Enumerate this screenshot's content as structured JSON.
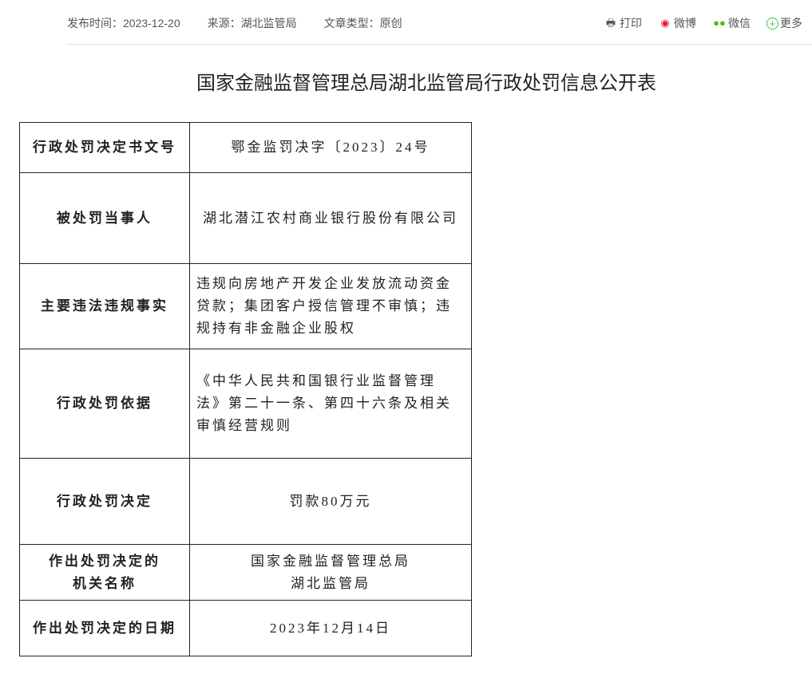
{
  "meta": {
    "date": "发布时间：2023-12-20",
    "source": "来源：湖北监管局",
    "type": "文章类型：原创"
  },
  "share": {
    "print": "打印",
    "weibo": "微博",
    "wechat": "微信",
    "more": "更多"
  },
  "title": "国家金融监督管理总局湖北监管局行政处罚信息公开表",
  "rows": [
    {
      "key": [
        "行政处罚决定书文号"
      ],
      "value": [
        "鄂金监罚决字〔2023〕24号"
      ]
    },
    {
      "key": [
        "被处罚当事人"
      ],
      "value": [
        "湖北潜江农村商业银行股份有限公司"
      ]
    },
    {
      "key": [
        "主要违法违规事实"
      ],
      "value": [
        "违规向房地产开发企业发放流动资金",
        "贷款；集团客户授信管理不审慎；违",
        "规持有非金融企业股权"
      ]
    },
    {
      "key": [
        "行政处罚依据"
      ],
      "value": [
        "《中华人民共和国银行业监督管理",
        "法》第二十一条、第四十六条及相关",
        "审慎经营规则"
      ]
    },
    {
      "key": [
        "行政处罚决定"
      ],
      "value": [
        "罚款80万元"
      ]
    },
    {
      "key": [
        "作出处罚决定的",
        "机关名称"
      ],
      "value": [
        "国家金融监督管理总局",
        "湖北监管局"
      ]
    },
    {
      "key": [
        "作出处罚决定的日期"
      ],
      "value": [
        "2023年12月14日"
      ]
    }
  ]
}
